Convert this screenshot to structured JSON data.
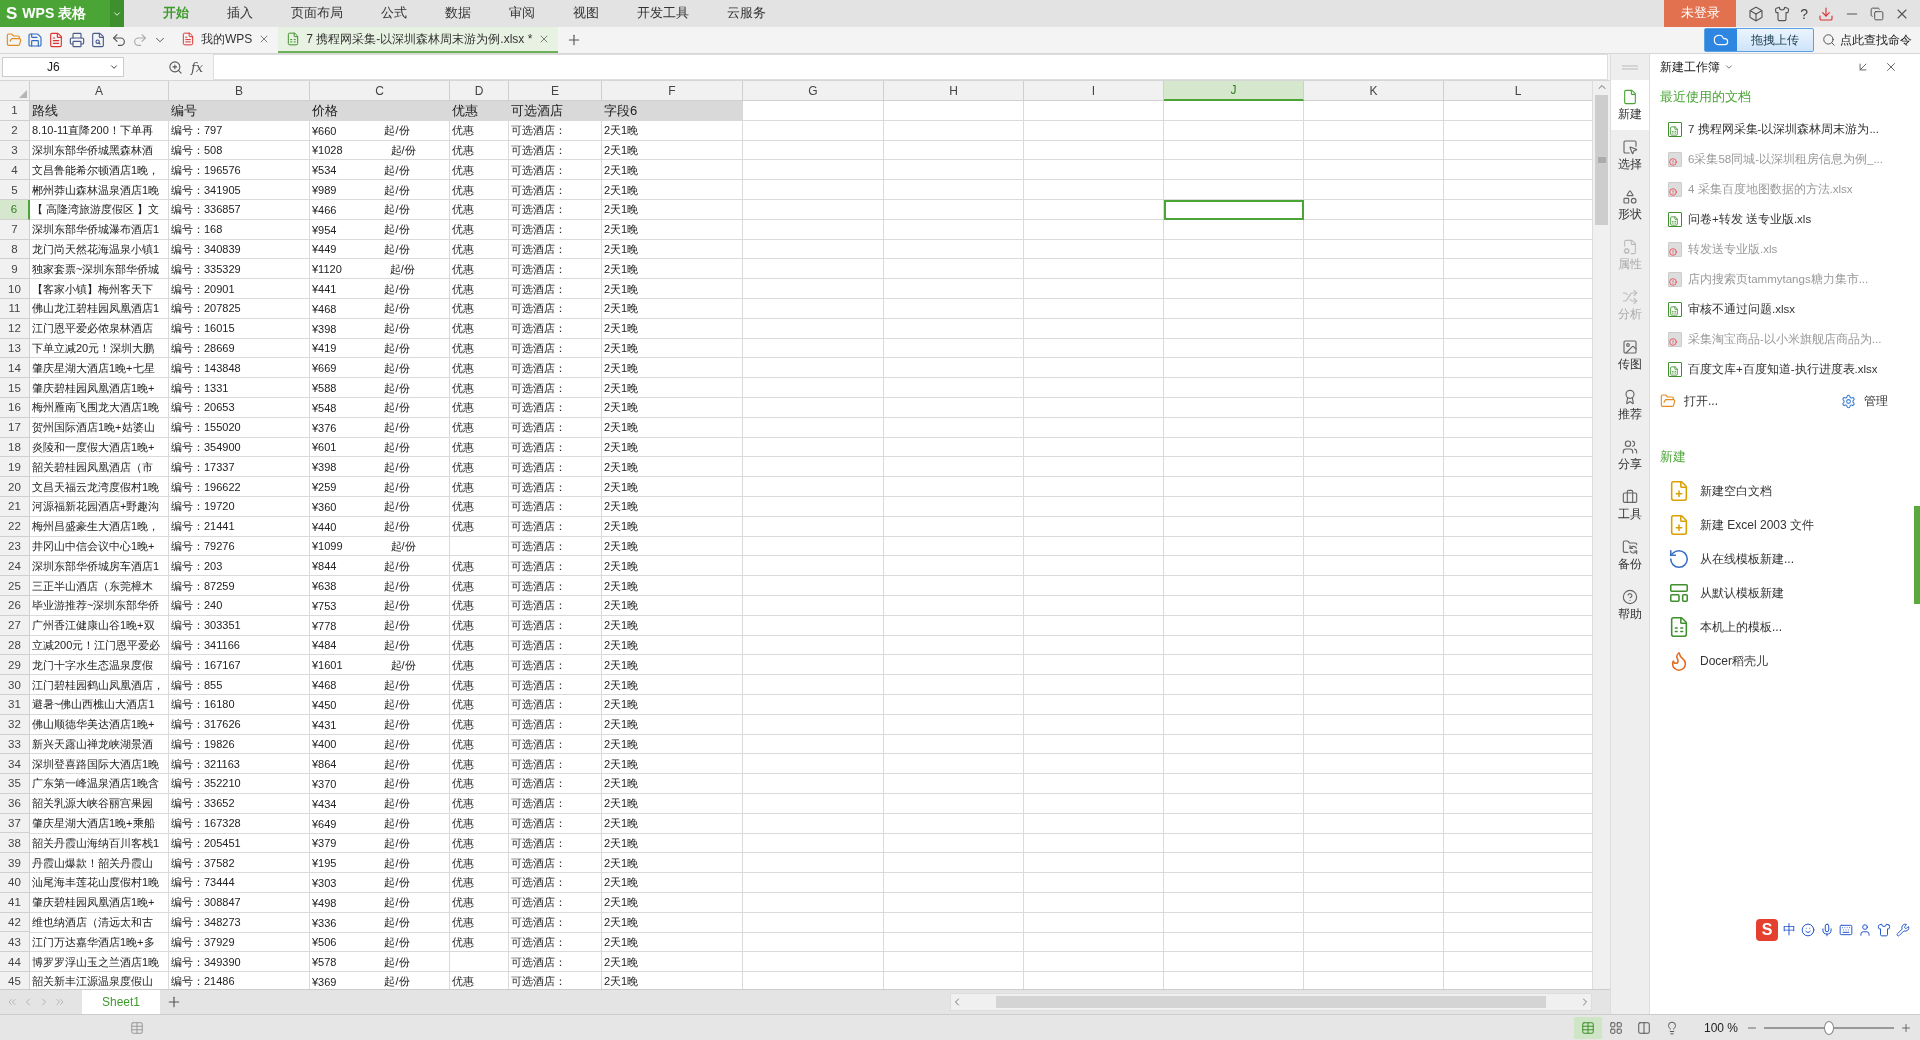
{
  "app": {
    "logo": "S",
    "name": "WPS 表格"
  },
  "menu": [
    {
      "label": "开始",
      "selected": true
    },
    {
      "label": "插入",
      "selected": false
    },
    {
      "label": "页面布局",
      "selected": false
    },
    {
      "label": "公式",
      "selected": false
    },
    {
      "label": "数据",
      "selected": false
    },
    {
      "label": "审阅",
      "selected": false
    },
    {
      "label": "视图",
      "selected": false
    },
    {
      "label": "开发工具",
      "selected": false
    },
    {
      "label": "云服务",
      "selected": false
    }
  ],
  "login_button": "未登录",
  "help_label": "?",
  "doc_tabs": [
    {
      "label": "我的WPS",
      "kind": "home",
      "selected": false
    },
    {
      "label": "7 携程网采集-以深圳森林周末游为例.xlsx *",
      "kind": "sheet",
      "selected": true
    }
  ],
  "upload_button": "拖拽上传",
  "command_search": "点此查找命令",
  "formula_bar": {
    "name_box": "J6",
    "function_label": "fx"
  },
  "columns": [
    {
      "letter": "A",
      "selected": false
    },
    {
      "letter": "B",
      "selected": false
    },
    {
      "letter": "C",
      "selected": false
    },
    {
      "letter": "D",
      "selected": false
    },
    {
      "letter": "E",
      "selected": false
    },
    {
      "letter": "F",
      "selected": false
    },
    {
      "letter": "G",
      "selected": false
    },
    {
      "letter": "H",
      "selected": false
    },
    {
      "letter": "I",
      "selected": false
    },
    {
      "letter": "J",
      "selected": true
    },
    {
      "letter": "K",
      "selected": false
    },
    {
      "letter": "L",
      "selected": false
    }
  ],
  "header_row": {
    "number": "1",
    "cells": [
      "路线",
      "编号",
      "价格",
      "优惠",
      "可选酒店",
      "字段6"
    ]
  },
  "rows": [
    {
      "number": "2",
      "selected": false,
      "route": "8.10-11直降200！下单再",
      "code": "编号：797",
      "price": "¥660",
      "unit": "起/份",
      "discount": "优惠",
      "hotel": "可选酒店：",
      "duration": "2天1晚"
    },
    {
      "number": "3",
      "selected": false,
      "route": "深圳东部华侨城黑森林酒",
      "code": "编号：508",
      "price": "¥1028",
      "unit": "起/份",
      "discount": "优惠",
      "hotel": "可选酒店：",
      "duration": "2天1晚"
    },
    {
      "number": "4",
      "selected": false,
      "route": "文昌鲁能希尔顿酒店1晚，",
      "code": "编号：196576",
      "price": "¥534",
      "unit": "起/份",
      "discount": "优惠",
      "hotel": "可选酒店：",
      "duration": "2天1晚"
    },
    {
      "number": "5",
      "selected": false,
      "route": "郴州莽山森林温泉酒店1晚",
      "code": "编号：341905",
      "price": "¥989",
      "unit": "起/份",
      "discount": "优惠",
      "hotel": "可选酒店：",
      "duration": "2天1晚"
    },
    {
      "number": "6",
      "selected": true,
      "route": "【 高隆湾旅游度假区 】文",
      "code": "编号：336857",
      "price": "¥466",
      "unit": "起/份",
      "discount": "优惠",
      "hotel": "可选酒店：",
      "duration": "2天1晚"
    },
    {
      "number": "7",
      "selected": false,
      "route": "深圳东部华侨城瀑布酒店1",
      "code": "编号：168",
      "price": "¥954",
      "unit": "起/份",
      "discount": "优惠",
      "hotel": "可选酒店：",
      "duration": "2天1晚"
    },
    {
      "number": "8",
      "selected": false,
      "route": "龙门尚天然花海温泉小镇1",
      "code": "编号：340839",
      "price": "¥449",
      "unit": "起/份",
      "discount": "优惠",
      "hotel": "可选酒店：",
      "duration": "2天1晚"
    },
    {
      "number": "9",
      "selected": false,
      "route": "独家套票~深圳东部华侨城",
      "code": "编号：335329",
      "price": "¥1120",
      "unit": "起/份",
      "discount": "优惠",
      "hotel": "可选酒店：",
      "duration": "2天1晚"
    },
    {
      "number": "10",
      "selected": false,
      "route": "【客家小镇】梅州客天下",
      "code": "编号：20901",
      "price": "¥441",
      "unit": "起/份",
      "discount": "优惠",
      "hotel": "可选酒店：",
      "duration": "2天1晚"
    },
    {
      "number": "11",
      "selected": false,
      "route": "佛山龙江碧桂园凤凰酒店1",
      "code": "编号：207825",
      "price": "¥468",
      "unit": "起/份",
      "discount": "优惠",
      "hotel": "可选酒店：",
      "duration": "2天1晚"
    },
    {
      "number": "12",
      "selected": false,
      "route": "江门恩平爱必侬泉林酒店",
      "code": "编号：16015",
      "price": "¥398",
      "unit": "起/份",
      "discount": "优惠",
      "hotel": "可选酒店：",
      "duration": "2天1晚"
    },
    {
      "number": "13",
      "selected": false,
      "route": "下单立减20元！深圳大鹏",
      "code": "编号：28669",
      "price": "¥419",
      "unit": "起/份",
      "discount": "优惠",
      "hotel": "可选酒店：",
      "duration": "2天1晚"
    },
    {
      "number": "14",
      "selected": false,
      "route": "肇庆星湖大酒店1晚+七星",
      "code": "编号：143848",
      "price": "¥669",
      "unit": "起/份",
      "discount": "优惠",
      "hotel": "可选酒店：",
      "duration": "2天1晚"
    },
    {
      "number": "15",
      "selected": false,
      "route": "肇庆碧桂园凤凰酒店1晚+",
      "code": "编号：1331",
      "price": "¥588",
      "unit": "起/份",
      "discount": "优惠",
      "hotel": "可选酒店：",
      "duration": "2天1晚"
    },
    {
      "number": "16",
      "selected": false,
      "route": "梅州雁南飞围龙大酒店1晚",
      "code": "编号：20653",
      "price": "¥548",
      "unit": "起/份",
      "discount": "优惠",
      "hotel": "可选酒店：",
      "duration": "2天1晚"
    },
    {
      "number": "17",
      "selected": false,
      "route": "贺州国际酒店1晚+姑婆山",
      "code": "编号：155020",
      "price": "¥376",
      "unit": "起/份",
      "discount": "优惠",
      "hotel": "可选酒店：",
      "duration": "2天1晚"
    },
    {
      "number": "18",
      "selected": false,
      "route": "炎陵和一度假大酒店1晚+",
      "code": "编号：354900",
      "price": "¥601",
      "unit": "起/份",
      "discount": "优惠",
      "hotel": "可选酒店：",
      "duration": "2天1晚"
    },
    {
      "number": "19",
      "selected": false,
      "route": "韶关碧桂园凤凰酒店（市",
      "code": "编号：17337",
      "price": "¥398",
      "unit": "起/份",
      "discount": "优惠",
      "hotel": "可选酒店：",
      "duration": "2天1晚"
    },
    {
      "number": "20",
      "selected": false,
      "route": "文昌天福云龙湾度假村1晚",
      "code": "编号：196622",
      "price": "¥259",
      "unit": "起/份",
      "discount": "优惠",
      "hotel": "可选酒店：",
      "duration": "2天1晚"
    },
    {
      "number": "21",
      "selected": false,
      "route": "河源福新花园酒店+野趣沟",
      "code": "编号：19720",
      "price": "¥360",
      "unit": "起/份",
      "discount": "优惠",
      "hotel": "可选酒店：",
      "duration": "2天1晚"
    },
    {
      "number": "22",
      "selected": false,
      "route": "梅州昌盛豪生大酒店1晚，",
      "code": "编号：21441",
      "price": "¥440",
      "unit": "起/份",
      "discount": "优惠",
      "hotel": "可选酒店：",
      "duration": "2天1晚"
    },
    {
      "number": "23",
      "selected": false,
      "route": "井冈山中信会议中心1晚+",
      "code": "编号：79276",
      "price": "¥1099",
      "unit": "起/份",
      "hotel": "可选酒店：",
      "duration": "2天1晚"
    },
    {
      "number": "24",
      "selected": false,
      "route": "深圳东部华侨城房车酒店1",
      "code": "编号：203",
      "price": "¥844",
      "unit": "起/份",
      "discount": "优惠",
      "hotel": "可选酒店：",
      "duration": "2天1晚"
    },
    {
      "number": "25",
      "selected": false,
      "route": "三正半山酒店（东莞樟木",
      "code": "编号：87259",
      "price": "¥638",
      "unit": "起/份",
      "discount": "优惠",
      "hotel": "可选酒店：",
      "duration": "2天1晚"
    },
    {
      "number": "26",
      "selected": false,
      "route": "毕业游推荐~深圳东部华侨",
      "code": "编号：240",
      "price": "¥753",
      "unit": "起/份",
      "discount": "优惠",
      "hotel": "可选酒店：",
      "duration": "2天1晚"
    },
    {
      "number": "27",
      "selected": false,
      "route": "广州香江健康山谷1晚+双",
      "code": "编号：303351",
      "price": "¥778",
      "unit": "起/份",
      "discount": "优惠",
      "hotel": "可选酒店：",
      "duration": "2天1晚"
    },
    {
      "number": "28",
      "selected": false,
      "route": "立减200元！江门恩平爱必",
      "code": "编号：341166",
      "price": "¥484",
      "unit": "起/份",
      "discount": "优惠",
      "hotel": "可选酒店：",
      "duration": "2天1晚"
    },
    {
      "number": "29",
      "selected": false,
      "route": "龙门十字水生态温泉度假",
      "code": "编号：167167",
      "price": "¥1601",
      "unit": "起/份",
      "discount": "优惠",
      "hotel": "可选酒店：",
      "duration": "2天1晚"
    },
    {
      "number": "30",
      "selected": false,
      "route": "江门碧桂园鹤山凤凰酒店，",
      "code": "编号：855",
      "price": "¥468",
      "unit": "起/份",
      "discount": "优惠",
      "hotel": "可选酒店：",
      "duration": "2天1晚"
    },
    {
      "number": "31",
      "selected": false,
      "route": "避暑~佛山西樵山大酒店1",
      "code": "编号：16180",
      "price": "¥450",
      "unit": "起/份",
      "discount": "优惠",
      "hotel": "可选酒店：",
      "duration": "2天1晚"
    },
    {
      "number": "32",
      "selected": false,
      "route": "佛山顺德华美达酒店1晚+",
      "code": "编号：317626",
      "price": "¥431",
      "unit": "起/份",
      "discount": "优惠",
      "hotel": "可选酒店：",
      "duration": "2天1晚"
    },
    {
      "number": "33",
      "selected": false,
      "route": "新兴天露山禅龙峡湖景酒",
      "code": "编号：19826",
      "price": "¥400",
      "unit": "起/份",
      "discount": "优惠",
      "hotel": "可选酒店：",
      "duration": "2天1晚"
    },
    {
      "number": "34",
      "selected": false,
      "route": "深圳登喜路国际大酒店1晚",
      "code": "编号：321163",
      "price": "¥864",
      "unit": "起/份",
      "discount": "优惠",
      "hotel": "可选酒店：",
      "duration": "2天1晚"
    },
    {
      "number": "35",
      "selected": false,
      "route": "广东第一峰温泉酒店1晚含",
      "code": "编号：352210",
      "price": "¥370",
      "unit": "起/份",
      "discount": "优惠",
      "hotel": "可选酒店：",
      "duration": "2天1晚"
    },
    {
      "number": "36",
      "selected": false,
      "route": "韶关乳源大峡谷丽宫果园",
      "code": "编号：33652",
      "price": "¥434",
      "unit": "起/份",
      "discount": "优惠",
      "hotel": "可选酒店：",
      "duration": "2天1晚"
    },
    {
      "number": "37",
      "selected": false,
      "route": "肇庆星湖大酒店1晚+乘船",
      "code": "编号：167328",
      "price": "¥649",
      "unit": "起/份",
      "discount": "优惠",
      "hotel": "可选酒店：",
      "duration": "2天1晚"
    },
    {
      "number": "38",
      "selected": false,
      "route": "韶关丹霞山海纳百川客栈1",
      "code": "编号：205451",
      "price": "¥379",
      "unit": "起/份",
      "discount": "优惠",
      "hotel": "可选酒店：",
      "duration": "2天1晚"
    },
    {
      "number": "39",
      "selected": false,
      "route": "丹霞山爆款！韶关丹霞山",
      "code": "编号：37582",
      "price": "¥195",
      "unit": "起/份",
      "discount": "优惠",
      "hotel": "可选酒店：",
      "duration": "2天1晚"
    },
    {
      "number": "40",
      "selected": false,
      "route": "汕尾海丰莲花山度假村1晚",
      "code": "编号：73444",
      "price": "¥303",
      "unit": "起/份",
      "discount": "优惠",
      "hotel": "可选酒店：",
      "duration": "2天1晚"
    },
    {
      "number": "41",
      "selected": false,
      "route": "肇庆碧桂园凤凰酒店1晚+",
      "code": "编号：308847",
      "price": "¥498",
      "unit": "起/份",
      "discount": "优惠",
      "hotel": "可选酒店：",
      "duration": "2天1晚"
    },
    {
      "number": "42",
      "selected": false,
      "route": "维也纳酒店（清远太和古",
      "code": "编号：348273",
      "price": "¥336",
      "unit": "起/份",
      "discount": "优惠",
      "hotel": "可选酒店：",
      "duration": "2天1晚"
    },
    {
      "number": "43",
      "selected": false,
      "route": "江门万达嘉华酒店1晚+多",
      "code": "编号：37929",
      "price": "¥506",
      "unit": "起/份",
      "discount": "优惠",
      "hotel": "可选酒店：",
      "duration": "2天1晚"
    },
    {
      "number": "44",
      "selected": false,
      "route": "博罗罗浮山玉之兰酒店1晚",
      "code": "编号：349390",
      "price": "¥578",
      "unit": "起/份",
      "hotel": "可选酒店：",
      "duration": "2天1晚"
    },
    {
      "number": "45",
      "selected": false,
      "route": "韶关新丰江源温泉度假山",
      "code": "编号：21486",
      "price": "¥369",
      "unit": "起/份",
      "discount": "优惠",
      "hotel": "可选酒店：",
      "duration": "2天1晚"
    }
  ],
  "sheet_tabs": [
    {
      "label": "Sheet1",
      "selected": true
    }
  ],
  "side_tools": [
    {
      "label": "新建",
      "selected": true,
      "disabled": false
    },
    {
      "label": "选择",
      "selected": false,
      "disabled": false
    },
    {
      "label": "形状",
      "selected": false,
      "disabled": false
    },
    {
      "label": "属性",
      "selected": false,
      "disabled": true
    },
    {
      "label": "分析",
      "selected": false,
      "disabled": true
    },
    {
      "label": "传图",
      "selected": false,
      "disabled": false
    },
    {
      "label": "推荐",
      "selected": false,
      "disabled": false
    },
    {
      "label": "分享",
      "selected": false,
      "disabled": false
    },
    {
      "label": "工具",
      "selected": false,
      "disabled": false
    },
    {
      "label": "备份",
      "selected": false,
      "disabled": false
    },
    {
      "label": "帮助",
      "selected": false,
      "disabled": false
    }
  ],
  "panel": {
    "title": "新建工作簿",
    "recent_heading": "最近使用的文档",
    "recent": [
      {
        "name": "7 携程网采集-以深圳森林周末游为...",
        "missing": false
      },
      {
        "name": "6采集58同城-以深圳租房信息为例_...",
        "missing": true
      },
      {
        "name": "4 采集百度地图数据的方法.xlsx",
        "missing": true
      },
      {
        "name": "问卷+转发 送专业版.xls",
        "missing": false
      },
      {
        "name": "转发送专业版.xls",
        "missing": true
      },
      {
        "name": "店内搜索页tammytangs糖力集市...",
        "missing": true
      },
      {
        "name": "审核不通过问题.xlsx",
        "missing": false
      },
      {
        "name": "采集淘宝商品-以小米旗舰店商品为...",
        "missing": true
      },
      {
        "name": "百度文库+百度知道-执行进度表.xlsx",
        "missing": false
      }
    ],
    "open": "打开...",
    "manage": "管理",
    "new_heading": "新建",
    "new_items": [
      {
        "label": "新建空白文档",
        "kind": "blank"
      },
      {
        "label": "新建 Excel 2003 文件",
        "kind": "legacy"
      },
      {
        "label": "从在线模板新建...",
        "kind": "online"
      },
      {
        "label": "从默认模板新建",
        "kind": "default"
      },
      {
        "label": "本机上的模板...",
        "kind": "local"
      },
      {
        "label": "Docer稻壳儿",
        "kind": "docer"
      }
    ]
  },
  "ime": {
    "logo": "S",
    "mode": "中"
  },
  "status_bar": {
    "zoom": "100 %",
    "zoom_slider": {
      "level": 0.5
    }
  }
}
